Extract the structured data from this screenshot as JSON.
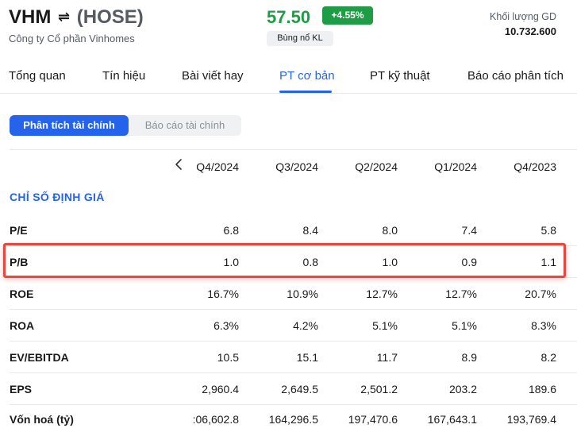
{
  "header": {
    "ticker": "VHM",
    "swap_icon": "⇌",
    "exchange": "(HOSE)",
    "company": "Công ty Cổ phần Vinhomes",
    "price": "57.50",
    "change": "+4.55%",
    "tag": "Bùng nổ KL",
    "volume_label": "Khối lượng GD",
    "volume_value": "10.732.600",
    "colors": {
      "up": "#1f9d46",
      "accent": "#2563eb",
      "highlight": "#e5483f"
    }
  },
  "tabs": [
    {
      "label": "Tổng quan"
    },
    {
      "label": "Tín hiệu"
    },
    {
      "label": "Bài viết hay"
    },
    {
      "label": "PT cơ bản",
      "active": true
    },
    {
      "label": "PT kỹ thuật"
    },
    {
      "label": "Báo cáo phân tích"
    }
  ],
  "subtabs": [
    {
      "label": "Phân tích tài chính",
      "active": true
    },
    {
      "label": "Báo cáo tài chính"
    }
  ],
  "table": {
    "prev_icon": "chevron-left-icon",
    "columns": [
      "Q4/2024",
      "Q3/2024",
      "Q2/2024",
      "Q1/2024",
      "Q4/2023"
    ],
    "section_title": "CHỈ SỐ ĐỊNH GIÁ",
    "rows": [
      {
        "label": "P/E",
        "values": [
          "6.8",
          "8.4",
          "8.0",
          "7.4",
          "5.8"
        ]
      },
      {
        "label": "P/B",
        "values": [
          "1.0",
          "0.8",
          "1.0",
          "0.9",
          "1.1"
        ]
      },
      {
        "label": "ROE",
        "values": [
          "16.7%",
          "10.9%",
          "12.7%",
          "12.7%",
          "20.7%"
        ]
      },
      {
        "label": "ROA",
        "values": [
          "6.3%",
          "4.2%",
          "5.1%",
          "5.1%",
          "8.3%"
        ]
      },
      {
        "label": "EV/EBITDA",
        "values": [
          "10.5",
          "15.1",
          "11.7",
          "8.9",
          "8.2"
        ]
      },
      {
        "label": "EPS",
        "values": [
          "2,960.4",
          "2,649.5",
          "2,501.2",
          "203.2",
          "189.6"
        ]
      },
      {
        "label": "Vốn hoá (tỷ)",
        "values": [
          ":06,602.8",
          "164,296.5",
          "197,470.6",
          "167,643.1",
          "193,769.4"
        ]
      }
    ]
  }
}
